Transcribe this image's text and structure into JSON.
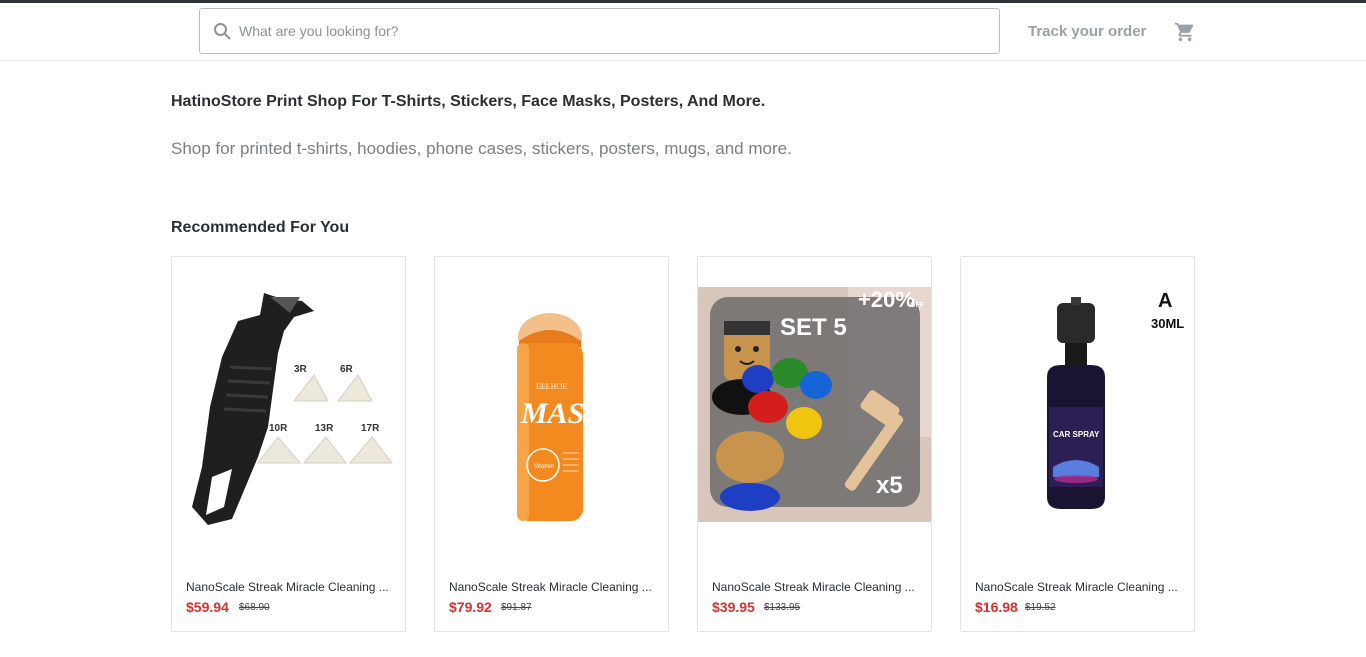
{
  "header": {
    "search_placeholder": "What are you looking for?",
    "track_order": "Track your order",
    "icons": {
      "search": "search-icon",
      "cart": "cart-icon"
    }
  },
  "main": {
    "title": "HatinoStore Print Shop For T-Shirts, Stickers, Face Masks, Posters, And More.",
    "description": "Shop for printed t-shirts, hoodies, phone cases, stickers, posters, mugs, and more."
  },
  "recommended": {
    "heading": "Recommended For You",
    "products": [
      {
        "name": "NanoScale Streak Miracle Cleaning ...",
        "price": "$59.94",
        "old_price": "$68.90",
        "image": "caulking-tool-set",
        "image_text": {
          "labels": [
            "3R",
            "6R",
            "10R",
            "13R",
            "17R"
          ]
        }
      },
      {
        "name": "NanoScale Streak Miracle Cleaning ...",
        "price": "$79.92",
        "old_price": "$91.87",
        "image": "mask-stick",
        "image_text": {
          "brand": "EELHOE",
          "product": "MASK",
          "sub": "Vitamin"
        }
      },
      {
        "name": "NanoScale Streak Miracle Cleaning ...",
        "price": "$39.95",
        "old_price": "$133.95",
        "image": "stacking-toy-set",
        "image_text": {
          "set": "SET 5",
          "discount": "+20%",
          "off": "OFF",
          "qty": "x5"
        }
      },
      {
        "name": "NanoScale Streak Miracle Cleaning ...",
        "price": "$16.98",
        "old_price": "$19.52",
        "image": "car-spray-bottle",
        "image_text": {
          "variant": "A",
          "volume": "30ML",
          "label": "CAR SPRAY"
        }
      }
    ]
  },
  "colors": {
    "price": "#d6312e",
    "muted": "#9aa0a6",
    "text": "#2b2f33"
  }
}
